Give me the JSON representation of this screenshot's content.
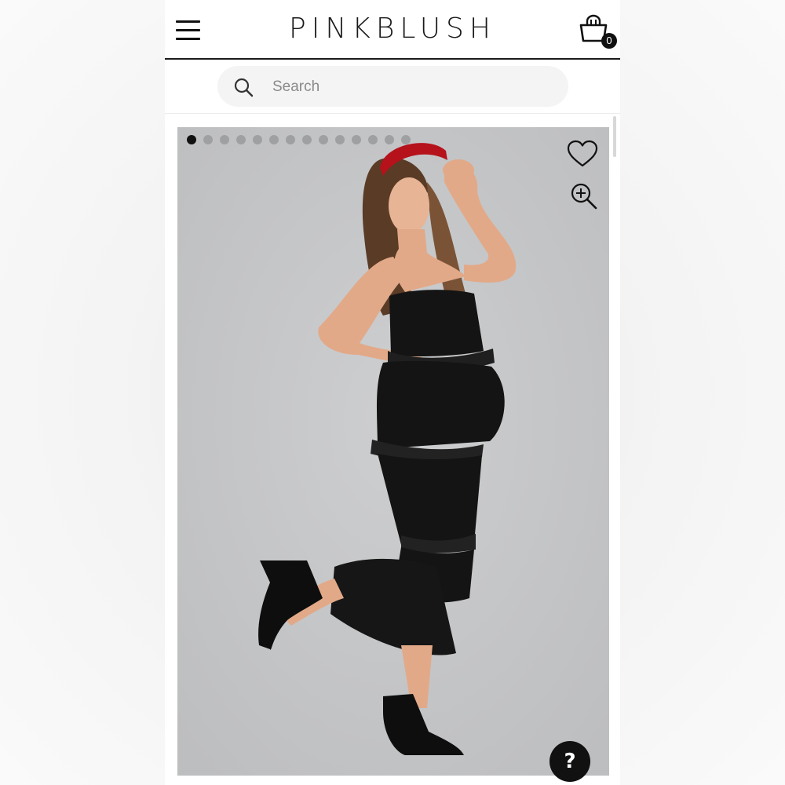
{
  "header": {
    "menu_icon": "hamburger-menu-icon",
    "logo_text": "PINKBLUSH",
    "cart_icon": "shopping-bag-icon",
    "cart_count": "0"
  },
  "search": {
    "icon": "search-icon",
    "placeholder": "Search"
  },
  "gallery": {
    "dot_count": 14,
    "active_index": 0,
    "favorite_icon": "heart-icon",
    "zoom_icon": "zoom-in-icon",
    "image_description_colors": {
      "backdrop": "#c7c8ca",
      "dress": "#141414",
      "headband": "#b5121b"
    }
  },
  "help": {
    "icon": "question-mark-icon",
    "label": "?"
  },
  "colors": {
    "accent": "#111111",
    "page_bg": "#ffffff"
  }
}
